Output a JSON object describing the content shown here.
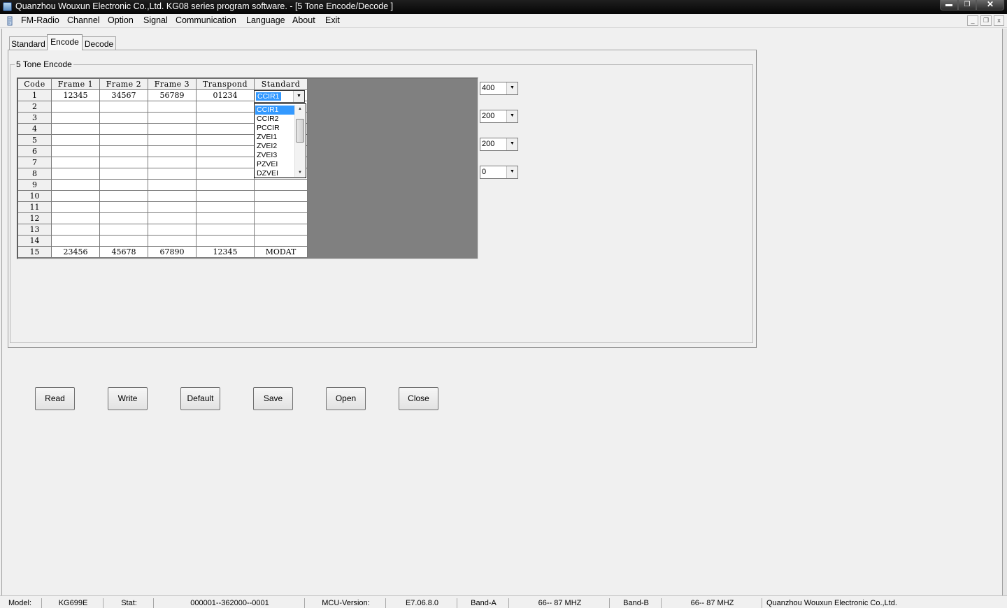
{
  "window": {
    "title": "Quanzhou Wouxun Electronic Co.,Ltd. KG08 series program software.  - [5 Tone Encode/Decode ]",
    "min_glyph": "▬",
    "max_glyph": "❐",
    "close_glyph": "✕"
  },
  "menu": {
    "items": [
      "FM-Radio",
      "Channel",
      "Option",
      "Signal",
      "Communication",
      "Language",
      "About",
      "Exit"
    ],
    "mdi_min": "_",
    "mdi_restore": "❐",
    "mdi_close": "x"
  },
  "tabs": [
    "Standard",
    "Encode",
    "Decode"
  ],
  "active_tab": "Encode",
  "group_label": "5 Tone Encode",
  "grid": {
    "headers": [
      "Code",
      "Frame 1",
      "Frame 2",
      "Frame 3",
      "Transpond",
      "Standard"
    ],
    "rows": [
      [
        "1",
        "12345",
        "34567",
        "56789",
        "01234",
        ""
      ],
      [
        "2",
        "",
        "",
        "",
        "",
        ""
      ],
      [
        "3",
        "",
        "",
        "",
        "",
        ""
      ],
      [
        "4",
        "",
        "",
        "",
        "",
        ""
      ],
      [
        "5",
        "",
        "",
        "",
        "",
        ""
      ],
      [
        "6",
        "",
        "",
        "",
        "",
        ""
      ],
      [
        "7",
        "",
        "",
        "",
        "",
        ""
      ],
      [
        "8",
        "",
        "",
        "",
        "",
        ""
      ],
      [
        "9",
        "",
        "",
        "",
        "",
        ""
      ],
      [
        "10",
        "",
        "",
        "",
        "",
        ""
      ],
      [
        "11",
        "",
        "",
        "",
        "",
        ""
      ],
      [
        "12",
        "",
        "",
        "",
        "",
        ""
      ],
      [
        "13",
        "",
        "",
        "",
        "",
        ""
      ],
      [
        "14",
        "",
        "",
        "",
        "",
        ""
      ],
      [
        "15",
        "23456",
        "45678",
        "67890",
        "12345",
        "MODAT"
      ]
    ]
  },
  "standard_combo": {
    "value": "CCIR1",
    "arrow": "▼",
    "options": [
      "CCIR1",
      "CCIR2",
      "PCCIR",
      "ZVEI1",
      "ZVEI2",
      "ZVEI3",
      "PZVEI",
      "DZVEI"
    ],
    "selected_index": 0,
    "scroll_up": "▲",
    "scroll_down": "▼"
  },
  "side_combos": [
    {
      "value": "400",
      "arrow": "▼"
    },
    {
      "value": "200",
      "arrow": "▼"
    },
    {
      "value": "200",
      "arrow": "▼"
    },
    {
      "value": "0",
      "arrow": "▼"
    }
  ],
  "buttons": [
    "Read",
    "Write",
    "Default",
    "Save",
    "Open",
    "Close"
  ],
  "status": {
    "model_label": "Model:",
    "model_value": "KG699E",
    "stat_label": "Stat:",
    "stat_value": "000001--362000--0001",
    "mcu_label": "MCU-Version:",
    "mcu_value": "E7.06.8.0",
    "band_a_label": "Band-A",
    "band_a_value": "66-- 87 MHZ",
    "band_b_label": "Band-B",
    "band_b_value": "66-- 87 MHZ",
    "company": "Quanzhou Wouxun Electronic Co.,Ltd."
  }
}
